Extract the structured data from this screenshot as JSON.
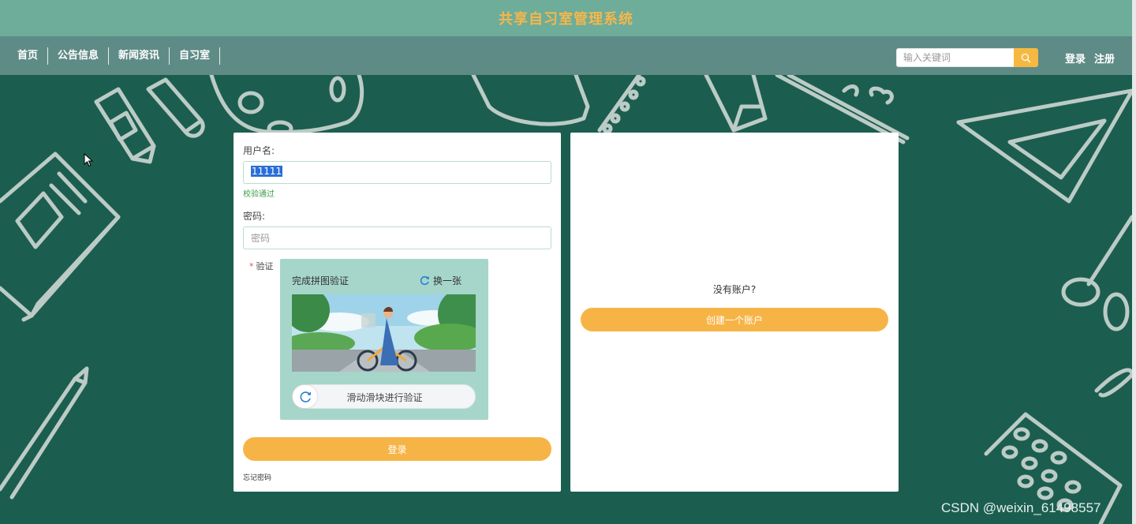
{
  "header": {
    "title": "共享自习室管理系统"
  },
  "nav": {
    "items": [
      {
        "label": "首页"
      },
      {
        "label": "公告信息"
      },
      {
        "label": "新闻资讯"
      },
      {
        "label": "自习室"
      }
    ],
    "search": {
      "placeholder": "输入关键词"
    },
    "login_label": "登录",
    "register_label": "注册"
  },
  "login_form": {
    "username_label": "用户名:",
    "username_value": "11111",
    "validation_message": "校验通过",
    "password_label": "密码:",
    "password_placeholder": "密码",
    "captcha_label": "验证",
    "captcha_title": "完成拼图验证",
    "captcha_refresh_label": "换一张",
    "slider_text": "滑动滑块进行验证",
    "submit_label": "登录",
    "forgot_label": "忘记密码"
  },
  "register_panel": {
    "prompt": "没有账户?",
    "create_label": "创建一个账户"
  },
  "watermark": "CSDN @weixin_61498557",
  "colors": {
    "background": "#1b5e50",
    "title_bar": "#6dad9a",
    "nav_bar": "#5f8b87",
    "accent_orange": "#f7b446",
    "captcha_bg": "#a6d6c9"
  }
}
